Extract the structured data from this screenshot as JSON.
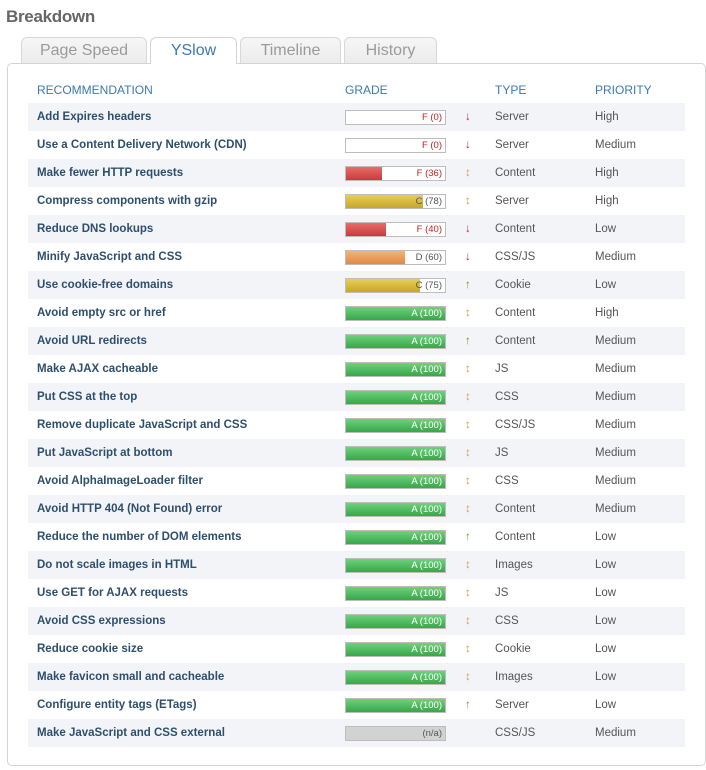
{
  "header": {
    "title": "Breakdown"
  },
  "tabs": [
    {
      "label": "Page Speed",
      "active": false
    },
    {
      "label": "YSlow",
      "active": true
    },
    {
      "label": "Timeline",
      "active": false
    },
    {
      "label": "History",
      "active": false
    }
  ],
  "table": {
    "columns": [
      "RECOMMENDATION",
      "GRADE",
      "TYPE",
      "PRIORITY"
    ],
    "rows": [
      {
        "recommendation": "Add Expires headers",
        "grade_label": "F (0)",
        "score": 0,
        "grade_color": "red",
        "trend": "down",
        "type": "Server",
        "priority": "High"
      },
      {
        "recommendation": "Use a Content Delivery Network (CDN)",
        "grade_label": "F (0)",
        "score": 0,
        "grade_color": "red",
        "trend": "down",
        "type": "Server",
        "priority": "Medium"
      },
      {
        "recommendation": "Make fewer HTTP requests",
        "grade_label": "F (36)",
        "score": 36,
        "grade_color": "red",
        "trend": "both",
        "type": "Content",
        "priority": "High"
      },
      {
        "recommendation": "Compress components with gzip",
        "grade_label": "C (78)",
        "score": 78,
        "grade_color": "yellow",
        "trend": "both",
        "type": "Server",
        "priority": "High"
      },
      {
        "recommendation": "Reduce DNS lookups",
        "grade_label": "F (40)",
        "score": 40,
        "grade_color": "red",
        "trend": "down",
        "type": "Content",
        "priority": "Low"
      },
      {
        "recommendation": "Minify JavaScript and CSS",
        "grade_label": "D (60)",
        "score": 60,
        "grade_color": "orange",
        "trend": "down",
        "type": "CSS/JS",
        "priority": "Medium"
      },
      {
        "recommendation": "Use cookie-free domains",
        "grade_label": "C (75)",
        "score": 75,
        "grade_color": "yellow",
        "trend": "up",
        "type": "Cookie",
        "priority": "Low"
      },
      {
        "recommendation": "Avoid empty src or href",
        "grade_label": "A (100)",
        "score": 100,
        "grade_color": "green",
        "trend": "both",
        "type": "Content",
        "priority": "High"
      },
      {
        "recommendation": "Avoid URL redirects",
        "grade_label": "A (100)",
        "score": 100,
        "grade_color": "green",
        "trend": "up",
        "type": "Content",
        "priority": "Medium"
      },
      {
        "recommendation": "Make AJAX cacheable",
        "grade_label": "A (100)",
        "score": 100,
        "grade_color": "green",
        "trend": "both",
        "type": "JS",
        "priority": "Medium"
      },
      {
        "recommendation": "Put CSS at the top",
        "grade_label": "A (100)",
        "score": 100,
        "grade_color": "green",
        "trend": "both",
        "type": "CSS",
        "priority": "Medium"
      },
      {
        "recommendation": "Remove duplicate JavaScript and CSS",
        "grade_label": "A (100)",
        "score": 100,
        "grade_color": "green",
        "trend": "both",
        "type": "CSS/JS",
        "priority": "Medium"
      },
      {
        "recommendation": "Put JavaScript at bottom",
        "grade_label": "A (100)",
        "score": 100,
        "grade_color": "green",
        "trend": "both",
        "type": "JS",
        "priority": "Medium"
      },
      {
        "recommendation": "Avoid AlphaImageLoader filter",
        "grade_label": "A (100)",
        "score": 100,
        "grade_color": "green",
        "trend": "both",
        "type": "CSS",
        "priority": "Medium"
      },
      {
        "recommendation": "Avoid HTTP 404 (Not Found) error",
        "grade_label": "A (100)",
        "score": 100,
        "grade_color": "green",
        "trend": "both",
        "type": "Content",
        "priority": "Medium"
      },
      {
        "recommendation": "Reduce the number of DOM elements",
        "grade_label": "A (100)",
        "score": 100,
        "grade_color": "green",
        "trend": "up",
        "type": "Content",
        "priority": "Low"
      },
      {
        "recommendation": "Do not scale images in HTML",
        "grade_label": "A (100)",
        "score": 100,
        "grade_color": "green",
        "trend": "both",
        "type": "Images",
        "priority": "Low"
      },
      {
        "recommendation": "Use GET for AJAX requests",
        "grade_label": "A (100)",
        "score": 100,
        "grade_color": "green",
        "trend": "both",
        "type": "JS",
        "priority": "Low"
      },
      {
        "recommendation": "Avoid CSS expressions",
        "grade_label": "A (100)",
        "score": 100,
        "grade_color": "green",
        "trend": "both",
        "type": "CSS",
        "priority": "Low"
      },
      {
        "recommendation": "Reduce cookie size",
        "grade_label": "A (100)",
        "score": 100,
        "grade_color": "green",
        "trend": "both",
        "type": "Cookie",
        "priority": "Low"
      },
      {
        "recommendation": "Make favicon small and cacheable",
        "grade_label": "A (100)",
        "score": 100,
        "grade_color": "green",
        "trend": "both",
        "type": "Images",
        "priority": "Low"
      },
      {
        "recommendation": "Configure entity tags (ETags)",
        "grade_label": "A (100)",
        "score": 100,
        "grade_color": "green",
        "trend": "up",
        "type": "Server",
        "priority": "Low"
      },
      {
        "recommendation": "Make JavaScript and CSS external",
        "grade_label": "(n/a)",
        "score": 100,
        "grade_color": "gray",
        "trend": "none",
        "type": "CSS/JS",
        "priority": "Medium"
      }
    ]
  },
  "icons": {
    "down": "arrow-down-icon",
    "up": "arrow-up-icon",
    "both": "arrow-up-down-icon"
  },
  "colors": {
    "accent": "#3b79b5",
    "red": "#c83a3a",
    "yellow": "#c6a62a",
    "orange": "#e08a3e",
    "green": "#37a749",
    "gray": "#d2d2d2"
  }
}
